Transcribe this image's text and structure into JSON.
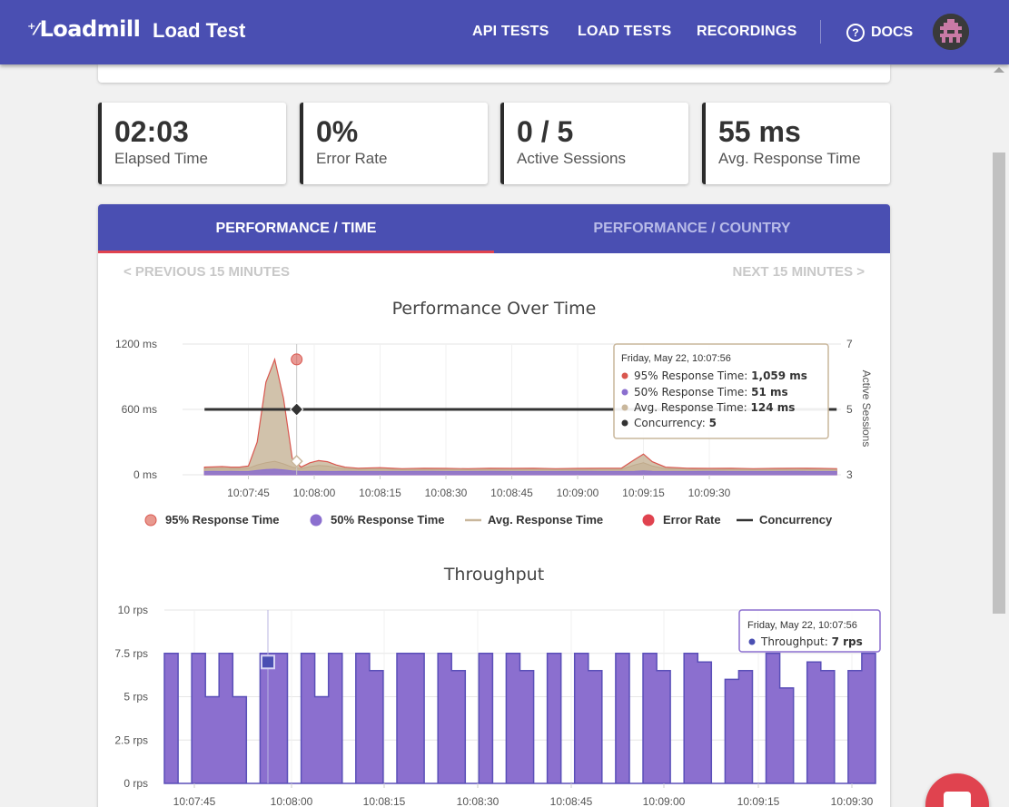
{
  "header": {
    "logo": "Loadmill",
    "page_title": "Load Test",
    "nav": [
      "API TESTS",
      "LOAD TESTS",
      "RECORDINGS"
    ],
    "docs": "DOCS"
  },
  "stats": [
    {
      "value": "02:03",
      "label": "Elapsed Time"
    },
    {
      "value": "0%",
      "label": "Error Rate"
    },
    {
      "value": "0 / 5",
      "label": "Active Sessions"
    },
    {
      "value": "55 ms",
      "label": "Avg. Response Time"
    }
  ],
  "tabs": {
    "active": "PERFORMANCE / TIME",
    "inactive": "PERFORMANCE / COUNTRY"
  },
  "pager": {
    "prev": "< PREVIOUS 15 MINUTES",
    "next": "NEXT 15 MINUTES >"
  },
  "colors": {
    "brand": "#4a4fb2",
    "accent": "#e0434f",
    "p95": "#d9574f",
    "p50": "#8b6fcf",
    "avg": "#c9b79c",
    "concurrency": "#333333",
    "throughput": "#8b6fcf"
  },
  "chart_data": [
    {
      "type": "area",
      "title": "Performance Over Time",
      "ylabel_right": "Active Sessions",
      "y_ticks": [
        "1200 ms",
        "600 ms",
        "0 ms"
      ],
      "y2_ticks": [
        "7",
        "5",
        "3"
      ],
      "ylim": [
        0,
        1200
      ],
      "y2lim": [
        3,
        7
      ],
      "x_ticks": [
        "10:07:45",
        "10:08:00",
        "10:08:15",
        "10:08:30",
        "10:08:45",
        "10:09:00",
        "10:09:15",
        "10:09:30"
      ],
      "x_seconds": [
        -10,
        -8,
        -6,
        -4,
        -2,
        0,
        2,
        4,
        6,
        8,
        10,
        12,
        14,
        16,
        18,
        20,
        22,
        25,
        30,
        35,
        40,
        45,
        50,
        55,
        60,
        65,
        70,
        75,
        80,
        85,
        88,
        90,
        92,
        95,
        100,
        105,
        110,
        115,
        120,
        125,
        130,
        134
      ],
      "series": [
        {
          "name": "95% Response Time",
          "values": [
            70,
            72,
            75,
            70,
            70,
            80,
            300,
            850,
            1059,
            700,
            150,
            70,
            110,
            130,
            120,
            90,
            70,
            60,
            65,
            55,
            60,
            58,
            55,
            60,
            58,
            60,
            55,
            58,
            60,
            60,
            140,
            190,
            120,
            70,
            60,
            58,
            60,
            55,
            58,
            60,
            58,
            55
          ]
        },
        {
          "name": "50% Response Time",
          "values": [
            30,
            32,
            30,
            31,
            30,
            30,
            40,
            48,
            51,
            45,
            35,
            30,
            32,
            31,
            30,
            30,
            31,
            30,
            30,
            30,
            31,
            30,
            30,
            31,
            30,
            30,
            30,
            31,
            30,
            30,
            32,
            35,
            32,
            30,
            30,
            31,
            30,
            30,
            30,
            31,
            30,
            30
          ]
        },
        {
          "name": "Avg. Response Time",
          "values": [
            55,
            57,
            58,
            55,
            55,
            60,
            90,
            110,
            124,
            100,
            70,
            55,
            75,
            85,
            80,
            65,
            55,
            50,
            52,
            48,
            50,
            49,
            48,
            50,
            49,
            50,
            48,
            49,
            50,
            50,
            90,
            110,
            80,
            55,
            50,
            49,
            50,
            48,
            49,
            50,
            49,
            48
          ]
        },
        {
          "name": "Error Rate",
          "values": []
        },
        {
          "name": "Concurrency",
          "values": [
            5,
            5,
            5,
            5,
            5,
            5,
            5,
            5,
            5,
            5,
            5,
            5,
            5,
            5,
            5,
            5,
            5,
            5,
            5,
            5,
            5,
            5,
            5,
            5,
            5,
            5,
            5,
            5,
            5,
            5,
            5,
            5,
            5,
            5,
            5,
            5,
            5,
            5,
            5,
            5,
            5,
            5
          ]
        }
      ],
      "legend": [
        "95% Response Time",
        "50% Response Time",
        "Avg. Response Time",
        "Error Rate",
        "Concurrency"
      ],
      "tooltip": {
        "time": "Friday, May 22, 10:07:56",
        "rows": [
          {
            "label": "95% Response Time: ",
            "value": "1,059 ms"
          },
          {
            "label": "50% Response Time: ",
            "value": "51 ms"
          },
          {
            "label": "Avg. Response Time: ",
            "value": "124 ms"
          },
          {
            "label": "Concurrency: ",
            "value": "5"
          }
        ]
      }
    },
    {
      "type": "area",
      "title": "Throughput",
      "y_ticks": [
        "10 rps",
        "7.5 rps",
        "5 rps",
        "2.5 rps",
        "0 rps"
      ],
      "ylim": [
        0,
        10
      ],
      "x_ticks": [
        "10:07:45",
        "10:08:00",
        "10:08:15",
        "10:08:30",
        "10:08:45",
        "10:09:00",
        "10:09:15",
        "10:09:30"
      ],
      "series": [
        {
          "name": "Throughput",
          "values": [
            7.5,
            0,
            7.5,
            5,
            7.5,
            5,
            0,
            7.5,
            7.5,
            0,
            7.5,
            5,
            7.5,
            0,
            7.5,
            6.5,
            0,
            7.5,
            7.5,
            0,
            7.5,
            6.5,
            0,
            7.5,
            0,
            7.5,
            6.5,
            0,
            7.5,
            0,
            7.5,
            6.5,
            0,
            7.5,
            0,
            7.5,
            6.5,
            0,
            7.5,
            7,
            0,
            6,
            6.5,
            0,
            7.5,
            5.5,
            0,
            7,
            6.5,
            0,
            6.5,
            7.5
          ]
        }
      ],
      "tooltip": {
        "time": "Friday, May 22, 10:07:56",
        "label": "Throughput: ",
        "value": "7 rps"
      }
    }
  ]
}
